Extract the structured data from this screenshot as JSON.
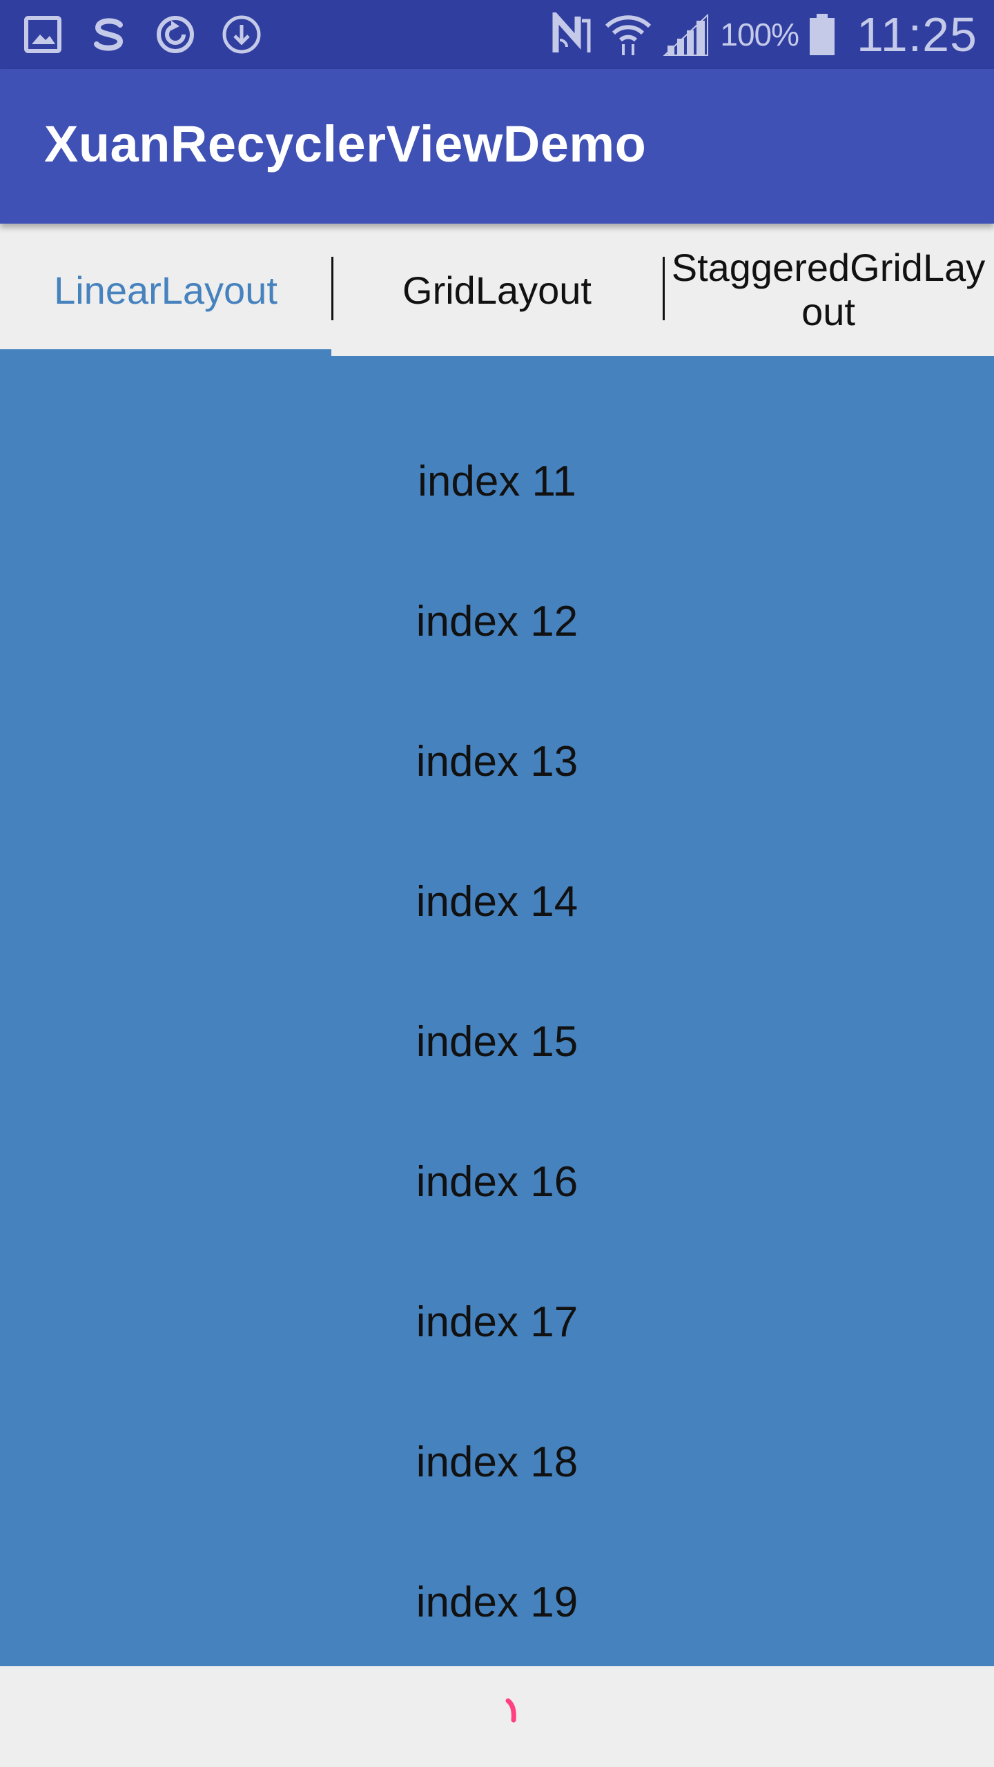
{
  "status_bar": {
    "left_icons": [
      "gallery-icon",
      "sogou-icon",
      "sync-icon",
      "download-icon"
    ],
    "right_icons": [
      "nfc-icon",
      "wifi-icon",
      "signal-icon"
    ],
    "battery": "100%",
    "time": "11:25"
  },
  "app_bar": {
    "title": "XuanRecyclerViewDemo"
  },
  "tabs": [
    {
      "label": "LinearLayout",
      "active": true
    },
    {
      "label": "GridLayout",
      "active": false
    },
    {
      "label": "StaggeredGridLayout",
      "active": false
    }
  ],
  "list": {
    "items": [
      "index 11",
      "index 12",
      "index 13",
      "index 14",
      "index 15",
      "index 16",
      "index 17",
      "index 18",
      "index 19"
    ]
  },
  "colors": {
    "status_bar": "#303f9f",
    "app_bar": "#3f51b5",
    "accent": "#4682be",
    "spinner": "#ff4081",
    "background": "#eeeeee"
  },
  "footer": {
    "spinner_icon": "loading-spinner-icon"
  }
}
